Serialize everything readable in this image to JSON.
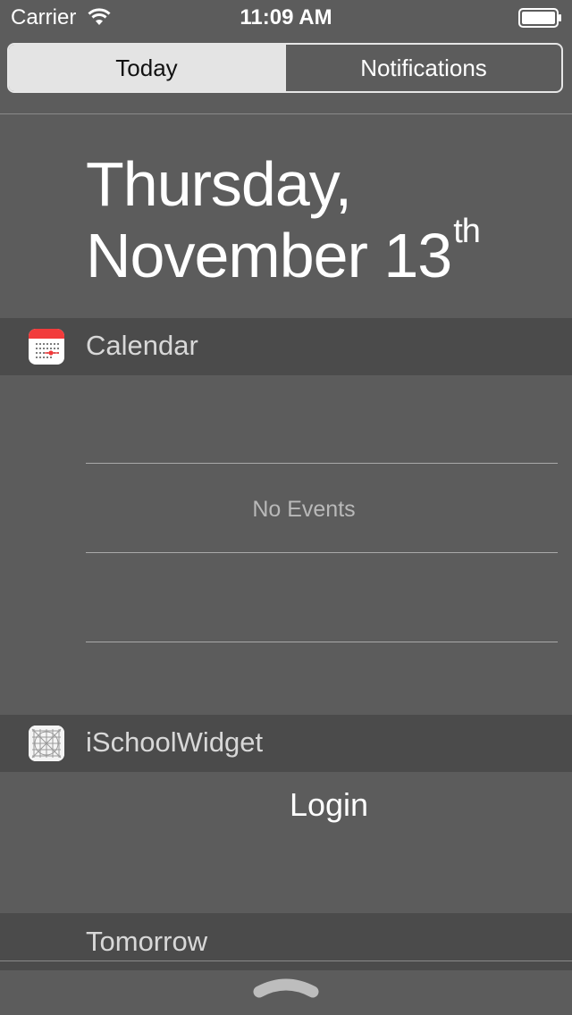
{
  "status_bar": {
    "carrier": "Carrier",
    "time": "11:09 AM",
    "wifi_icon": "wifi-icon",
    "battery_icon": "battery-icon"
  },
  "segmented_control": {
    "today_label": "Today",
    "notifications_label": "Notifications",
    "selected": "Today"
  },
  "date_header": {
    "line1": "Thursday,",
    "line2": "November 13",
    "ordinal_suffix": "th"
  },
  "calendar_section": {
    "title": "Calendar",
    "icon": "calendar-app-icon",
    "empty_text": "No Events"
  },
  "widget_section": {
    "title": "iSchoolWidget",
    "icon": "ischoolwidget-app-icon",
    "login_label": "Login"
  },
  "tomorrow_section": {
    "title": "Tomorrow"
  },
  "bottom_bar": {
    "grabber_icon": "chevron-up-grabber-icon"
  },
  "colors": {
    "background": "#5c5c5c",
    "section_header_bg": "#4b4b4b",
    "segment_selected_bg": "#e4e4e4",
    "calendar_icon_red": "#f23b3b"
  }
}
